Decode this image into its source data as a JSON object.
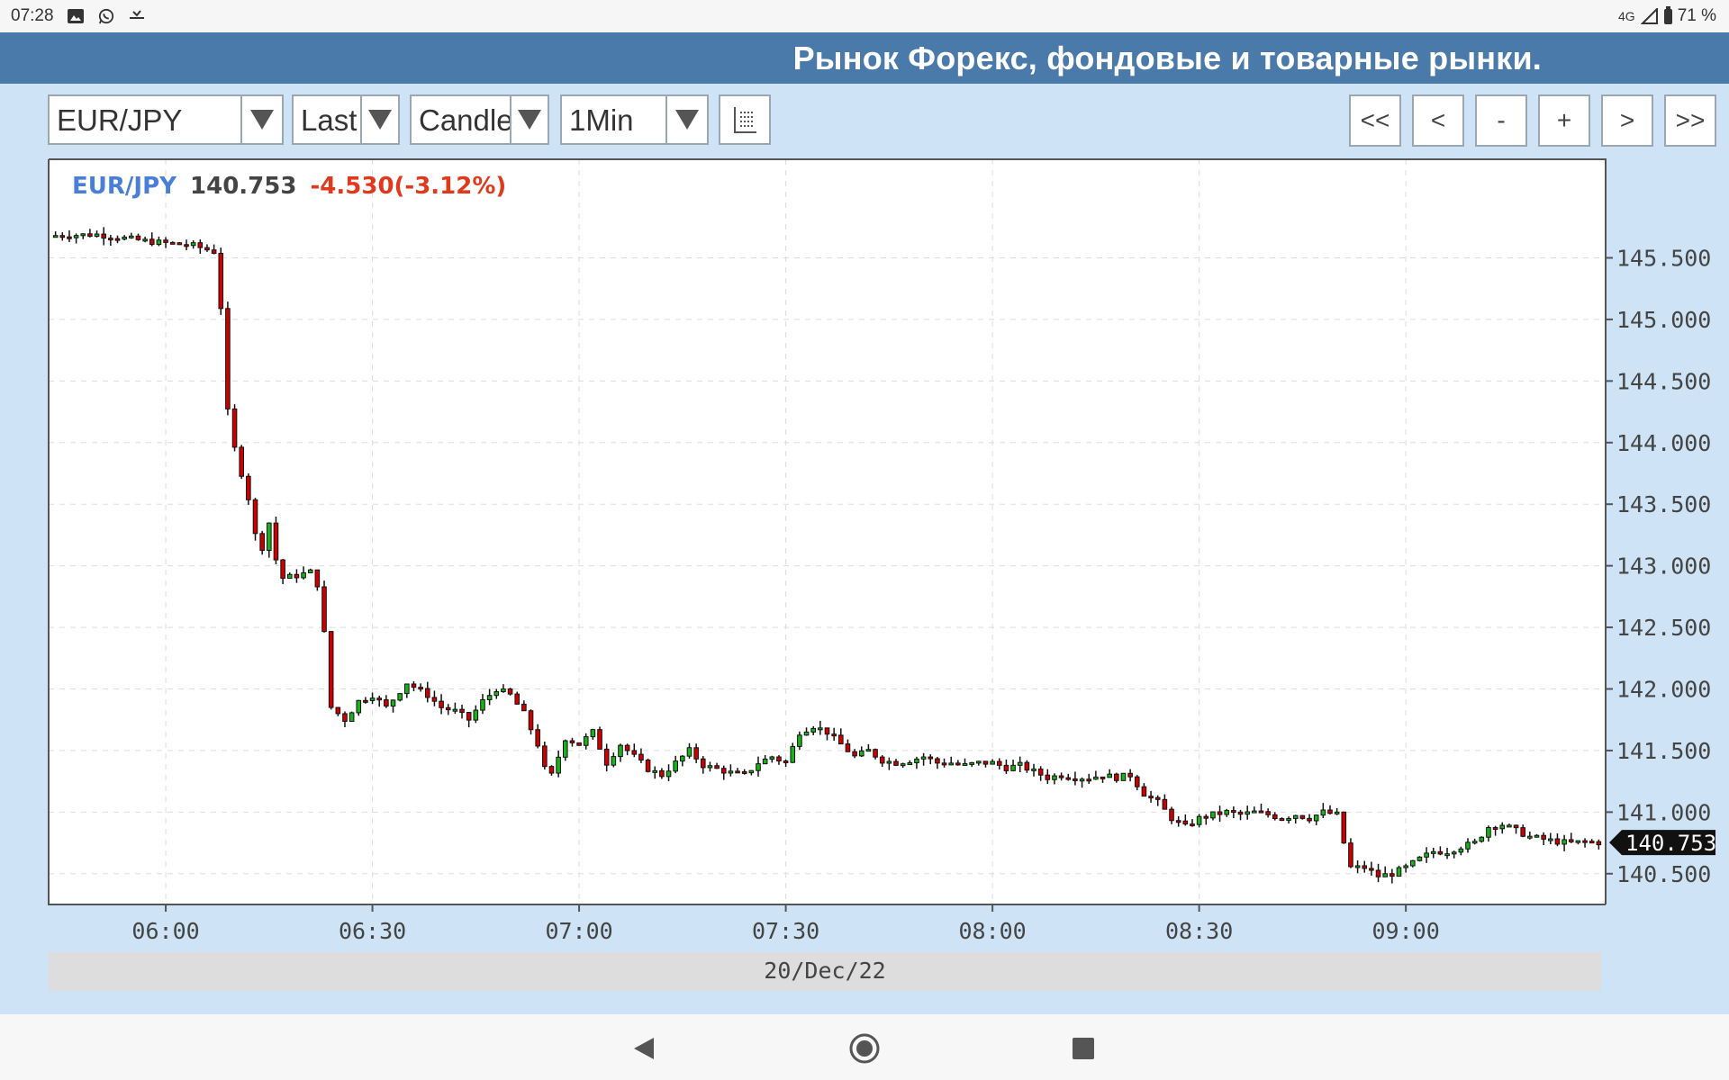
{
  "status_bar": {
    "time": "07:28",
    "left_icons": [
      "image-icon",
      "whatsapp-icon",
      "missed-call-icon"
    ],
    "network": "4G",
    "battery": "71 %"
  },
  "banner": {
    "title": "Рынок Форекс, фондовые и товарные рынки."
  },
  "toolbar": {
    "symbol": "EUR/JPY",
    "price_type": "Last",
    "chart_style": "Candle",
    "interval": "1Min",
    "indicators_icon": "list-icon",
    "nav_buttons": [
      "<<",
      "<",
      "-",
      "+",
      ">",
      ">>"
    ]
  },
  "quote": {
    "symbol": "EUR/JPY",
    "price": "140.753",
    "change": "-4.530(-3.12%)"
  },
  "colors": {
    "banner": "#4a7aaa",
    "panel": "#cfe3f6",
    "symbol": "#4a7fd8",
    "change": "#e03a1e",
    "up_candle": "#19b319",
    "down_candle": "#cc0000"
  },
  "chart_data": {
    "type": "candlestick",
    "title": "EUR/JPY",
    "date_label": "20/Dec/22",
    "x_ticks": [
      "06:00",
      "06:30",
      "07:00",
      "07:30",
      "08:00",
      "08:30",
      "09:00"
    ],
    "y_ticks": [
      "145.500",
      "145.000",
      "144.500",
      "144.000",
      "143.500",
      "143.000",
      "142.500",
      "142.000",
      "141.500",
      "141.000",
      "140.500"
    ],
    "ylim": [
      140.25,
      146.3
    ],
    "x_range_minutes": [
      -17,
      209
    ],
    "grid": true,
    "last_price": 140.753,
    "close_path": [
      [
        -17,
        145.68
      ],
      [
        -10,
        145.69
      ],
      [
        -2,
        145.63
      ],
      [
        4,
        145.6
      ],
      [
        7,
        145.55
      ],
      [
        8,
        145.1
      ],
      [
        9,
        144.25
      ],
      [
        10,
        143.95
      ],
      [
        11,
        143.75
      ],
      [
        12,
        143.55
      ],
      [
        13,
        143.25
      ],
      [
        14,
        143.15
      ],
      [
        15,
        143.35
      ],
      [
        16,
        143.05
      ],
      [
        17,
        142.9
      ],
      [
        19,
        142.92
      ],
      [
        21,
        142.95
      ],
      [
        22,
        142.85
      ],
      [
        23,
        142.45
      ],
      [
        24,
        141.85
      ],
      [
        26,
        141.75
      ],
      [
        28,
        141.9
      ],
      [
        30,
        141.95
      ],
      [
        32,
        141.85
      ],
      [
        35,
        142.05
      ],
      [
        38,
        141.95
      ],
      [
        40,
        141.85
      ],
      [
        42,
        141.82
      ],
      [
        44,
        141.75
      ],
      [
        46,
        141.9
      ],
      [
        48,
        142.0
      ],
      [
        50,
        141.95
      ],
      [
        52,
        141.8
      ],
      [
        54,
        141.55
      ],
      [
        55,
        141.35
      ],
      [
        56,
        141.3
      ],
      [
        58,
        141.6
      ],
      [
        60,
        141.55
      ],
      [
        62,
        141.65
      ],
      [
        64,
        141.4
      ],
      [
        66,
        141.55
      ],
      [
        68,
        141.45
      ],
      [
        70,
        141.35
      ],
      [
        72,
        141.3
      ],
      [
        74,
        141.4
      ],
      [
        76,
        141.5
      ],
      [
        78,
        141.38
      ],
      [
        80,
        141.35
      ],
      [
        82,
        141.32
      ],
      [
        84,
        141.3
      ],
      [
        86,
        141.4
      ],
      [
        88,
        141.45
      ],
      [
        90,
        141.4
      ],
      [
        92,
        141.65
      ],
      [
        94,
        141.7
      ],
      [
        96,
        141.65
      ],
      [
        98,
        141.55
      ],
      [
        100,
        141.45
      ],
      [
        102,
        141.5
      ],
      [
        104,
        141.42
      ],
      [
        106,
        141.4
      ],
      [
        108,
        141.42
      ],
      [
        110,
        141.45
      ],
      [
        112,
        141.4
      ],
      [
        114,
        141.4
      ],
      [
        116,
        141.38
      ],
      [
        118,
        141.4
      ],
      [
        120,
        141.4
      ],
      [
        122,
        141.36
      ],
      [
        124,
        141.38
      ],
      [
        126,
        141.33
      ],
      [
        128,
        141.28
      ],
      [
        130,
        141.3
      ],
      [
        132,
        141.28
      ],
      [
        134,
        141.28
      ],
      [
        136,
        141.3
      ],
      [
        138,
        141.28
      ],
      [
        140,
        141.3
      ],
      [
        142,
        141.15
      ],
      [
        144,
        141.08
      ],
      [
        146,
        140.95
      ],
      [
        148,
        140.88
      ],
      [
        150,
        140.95
      ],
      [
        152,
        140.98
      ],
      [
        154,
        141.0
      ],
      [
        156,
        140.98
      ],
      [
        158,
        141.0
      ],
      [
        160,
        140.98
      ],
      [
        162,
        140.95
      ],
      [
        164,
        140.98
      ],
      [
        166,
        140.95
      ],
      [
        168,
        141.0
      ],
      [
        170,
        140.98
      ],
      [
        171,
        140.75
      ],
      [
        172,
        140.55
      ],
      [
        174,
        140.55
      ],
      [
        176,
        140.48
      ],
      [
        178,
        140.5
      ],
      [
        180,
        140.55
      ],
      [
        182,
        140.62
      ],
      [
        184,
        140.68
      ],
      [
        186,
        140.68
      ],
      [
        188,
        140.72
      ],
      [
        190,
        140.75
      ],
      [
        192,
        140.88
      ],
      [
        194,
        140.9
      ],
      [
        196,
        140.85
      ],
      [
        198,
        140.8
      ],
      [
        200,
        140.78
      ],
      [
        202,
        140.76
      ],
      [
        204,
        140.75
      ],
      [
        206,
        140.76
      ],
      [
        208,
        140.753
      ]
    ]
  },
  "date_strip": "20/Dec/22",
  "nav_bar": [
    "back-icon",
    "home-icon",
    "recents-icon"
  ]
}
